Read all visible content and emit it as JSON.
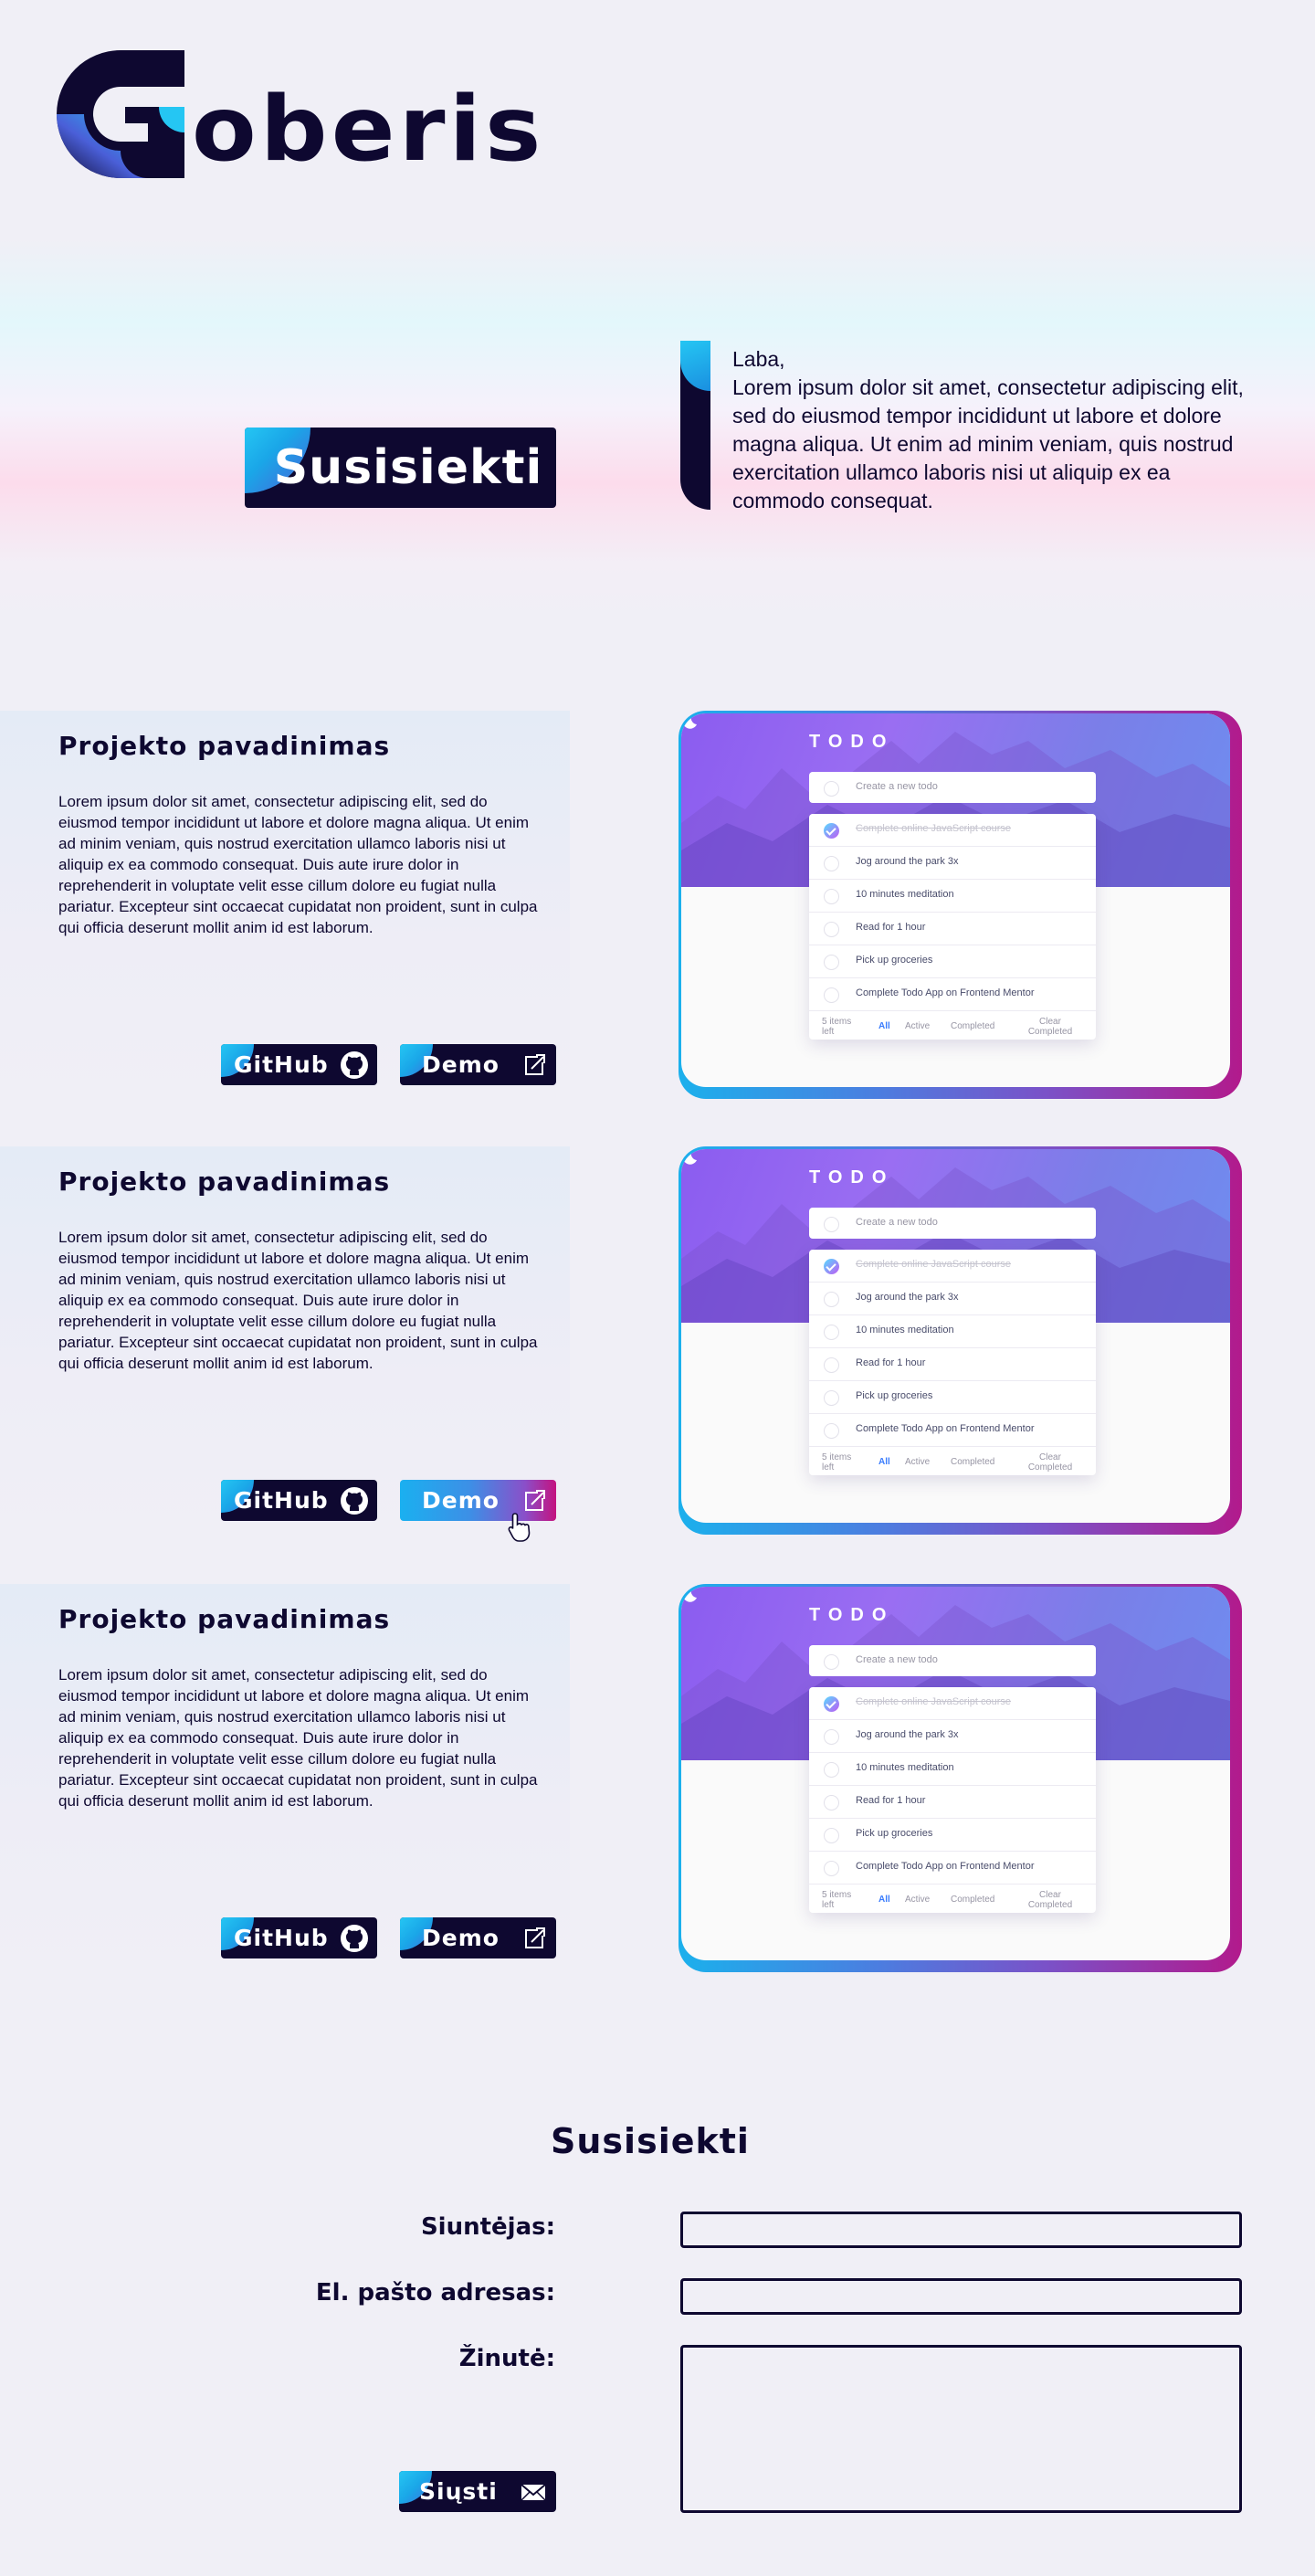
{
  "brand": {
    "logo_text": "oberis",
    "logo_letter": "G"
  },
  "hero": {
    "button_label": "Susisiekti",
    "greeting": "Laba,",
    "intro": "Lorem ipsum dolor sit amet, consectetur adipiscing elit, sed do eiusmod tempor incididunt ut labore et dolore magna aliqua. Ut enim ad minim veniam, quis nostrud exercitation ullamco laboris nisi ut aliquip ex ea commodo consequat."
  },
  "projects": [
    {
      "title": "Projekto pavadinimas",
      "description": "Lorem ipsum dolor sit amet, consectetur adipiscing elit, sed do eiusmod tempor incididunt ut labore et dolore magna aliqua. Ut enim ad minim veniam, quis nostrud exercitation ullamco laboris nisi ut aliquip ex ea commodo consequat. Duis aute irure dolor in reprehenderit in voluptate velit esse cillum dolore eu fugiat nulla pariatur. Excepteur sint occaecat cupidatat non proident, sunt in culpa qui officia deserunt mollit anim id est laborum.",
      "github_label": "GitHub",
      "demo_label": "Demo"
    },
    {
      "title": "Projekto pavadinimas",
      "description": "Lorem ipsum dolor sit amet, consectetur adipiscing elit, sed do eiusmod tempor incididunt ut labore et dolore magna aliqua. Ut enim ad minim veniam, quis nostrud exercitation ullamco laboris nisi ut aliquip ex ea commodo consequat. Duis aute irure dolor in reprehenderit in voluptate velit esse cillum dolore eu fugiat nulla pariatur. Excepteur sint occaecat cupidatat non proident, sunt in culpa qui officia deserunt mollit anim id est laborum.",
      "github_label": "GitHub",
      "demo_label": "Demo"
    },
    {
      "title": "Projekto pavadinimas",
      "description": "Lorem ipsum dolor sit amet, consectetur adipiscing elit, sed do eiusmod tempor incididunt ut labore et dolore magna aliqua. Ut enim ad minim veniam, quis nostrud exercitation ullamco laboris nisi ut aliquip ex ea commodo consequat. Duis aute irure dolor in reprehenderit in voluptate velit esse cillum dolore eu fugiat nulla pariatur. Excepteur sint occaecat cupidatat non proident, sunt in culpa qui officia deserunt mollit anim id est laborum.",
      "github_label": "GitHub",
      "demo_label": "Demo"
    }
  ],
  "todo_preview": {
    "title": "TODO",
    "new_placeholder": "Create a new todo",
    "items": [
      {
        "text": "Complete online JavaScript course",
        "done": true
      },
      {
        "text": "Jog around the park 3x",
        "done": false
      },
      {
        "text": "10 minutes meditation",
        "done": false
      },
      {
        "text": "Read for 1 hour",
        "done": false
      },
      {
        "text": "Pick up groceries",
        "done": false
      },
      {
        "text": "Complete Todo App on Frontend Mentor",
        "done": false
      }
    ],
    "footer": {
      "left": "5 items left",
      "all": "All",
      "active": "Active",
      "completed": "Completed",
      "clear": "Clear Completed"
    }
  },
  "contact": {
    "title": "Susisiekti",
    "sender_label": "Siuntėjas:",
    "sender_value": "",
    "email_label": "El. pašto adresas:",
    "email_value": "",
    "message_label": "Žinutė:",
    "message_value": "",
    "send_label": "Siųsti"
  },
  "colors": {
    "navy": "#0e0830",
    "accent_cyan": "#25c6f3",
    "accent_magenta": "#c4127f",
    "background": "#f0eff6"
  }
}
